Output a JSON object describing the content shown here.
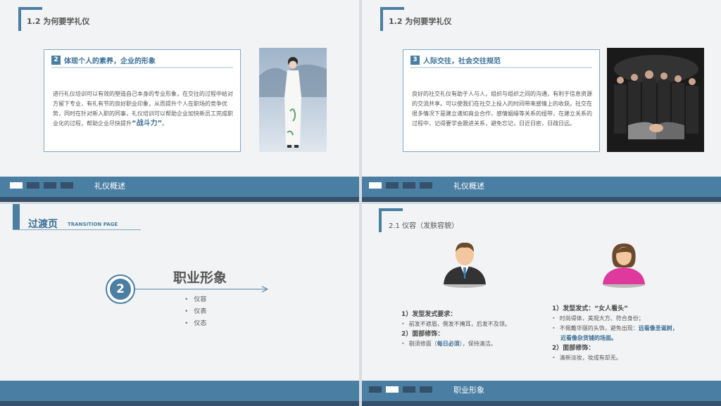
{
  "slide1": {
    "section": "1.2 为何要学礼仪",
    "card_num": "2",
    "card_title": "体现个人的素养，企业的形象",
    "card_body": "进行礼仪培训可以有效的塑造自己本身的专业形象，在交往的过程中给对方留下专业，有礼有节的良好职业印象，从而提升个人在职场的竞争优势，同时在针对新入职的同事，礼仪培训可以帮助企业加快新员工完成职业化的过程，帮助企业尽快提升",
    "card_highlight": "“战斗力”",
    "card_end": "。",
    "bar_label": "礼仪概述"
  },
  "slide2": {
    "section": "1.2 为何要学礼仪",
    "card_num": "3",
    "card_title": "人际交往，社会交往规范",
    "card_body": "良好的社交礼仪有助于人与人，组织与组织之间的沟通，有利于信息资源的交流共享。可以使我们在社交上投入的时间带来感情上的收获。社交在很多情况下是建立诸如商业合作，感情姻缘等关系的纽带，在建立关系的过程中，记得要学会跟进关系，避免忘记，日近日密，日疏日远。",
    "bar_label": "礼仪概述"
  },
  "slide3": {
    "title": "过渡页",
    "title_en": "TRANSITION PAGE",
    "number": "2",
    "heading": "职业形象",
    "items": [
      "仪容",
      "仪表",
      "仪态"
    ]
  },
  "slide4": {
    "section": "2.1  仪容（发肤容貌）",
    "male": {
      "h1": "1）发型发式要求：",
      "b1": "前发不遮眉，侧发不掩耳，后发不及领。",
      "h2": "2）面部修饰：",
      "b2_pre": "剔须修面（",
      "b2_hl": "每日必须",
      "b2_post": "），保持清洁。"
    },
    "female": {
      "h1": "1）发型发式：“女人看头”",
      "b1": "时尚得体，美观大方、符合身份；",
      "b2_pre": "不佩戴华丽的头饰，避免出现：",
      "b2_hl1": "远看像圣诞树，",
      "b2_hl2": "近看像杂货铺的场面。",
      "h2": "2）面部修饰：",
      "b3": "清新淡妆，妆成有却无。"
    },
    "bar_label": "职业形象"
  },
  "colors": {
    "accent": "#4a7ea3",
    "dark": "#34506a"
  }
}
